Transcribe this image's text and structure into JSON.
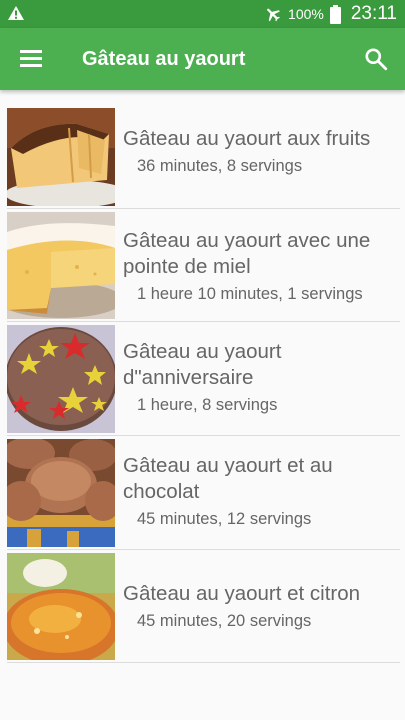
{
  "status_bar": {
    "battery": "100%",
    "time": "23:11"
  },
  "app_bar": {
    "title": "Gâteau au yaourt"
  },
  "icons": {
    "warning": "warning-icon",
    "airplane": "airplane-mode-icon",
    "battery": "battery-icon",
    "menu": "menu-icon",
    "search": "search-icon"
  },
  "colors": {
    "app_bar": "#4caf50",
    "status_bar": "#3a9a3e",
    "text": "#666666"
  },
  "recipes": [
    {
      "title": "Gâteau au yaourt aux fruits",
      "meta": "36 minutes, 8 servings",
      "image": "loaf-cake-photo"
    },
    {
      "title": "Gâteau au yaourt avec une pointe de miel",
      "meta": "1 heure 10 minutes, 1 servings",
      "image": "sponge-cake-photo"
    },
    {
      "title": "Gâteau au yaourt d\"anniversaire",
      "meta": "1 heure, 8 servings",
      "image": "star-cake-photo"
    },
    {
      "title": "Gâteau au yaourt et au chocolat",
      "meta": "45 minutes, 12 servings",
      "image": "chocolate-muffins-photo"
    },
    {
      "title": "Gâteau au yaourt et citron",
      "meta": "45 minutes, 20 servings",
      "image": "lemon-cake-photo"
    }
  ]
}
